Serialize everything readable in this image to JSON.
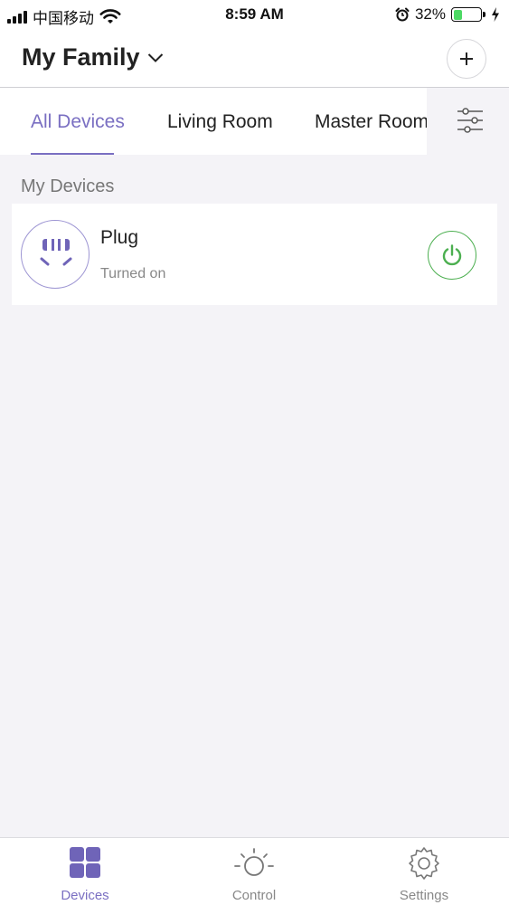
{
  "status_bar": {
    "carrier": "中国移动",
    "time": "8:59 AM",
    "battery_percent": "32%",
    "battery_level": 0.32,
    "icons": [
      "signal-icon",
      "wifi-icon",
      "alarm-icon",
      "battery-icon",
      "charging-icon"
    ]
  },
  "header": {
    "family_name": "My Family",
    "icons": [
      "chevron-down-icon",
      "plus-icon"
    ]
  },
  "tabs": {
    "items": [
      {
        "label": "All Devices",
        "active": true
      },
      {
        "label": "Living Room",
        "active": false
      },
      {
        "label": "Master Room",
        "active": false
      }
    ],
    "filter_icon": "sliders-icon"
  },
  "section": {
    "title": "My Devices"
  },
  "devices": [
    {
      "name": "Plug",
      "status": "Turned on",
      "icon": "plug-icon",
      "power": "on"
    }
  ],
  "bottom_nav": {
    "items": [
      {
        "label": "Devices",
        "icon": "grid-icon",
        "active": true
      },
      {
        "label": "Control",
        "icon": "sun-icon",
        "active": false
      },
      {
        "label": "Settings",
        "icon": "gear-icon",
        "active": false
      }
    ]
  },
  "colors": {
    "accent": "#7a6fc2",
    "power_on": "#4caf50",
    "background": "#f4f3f7"
  }
}
